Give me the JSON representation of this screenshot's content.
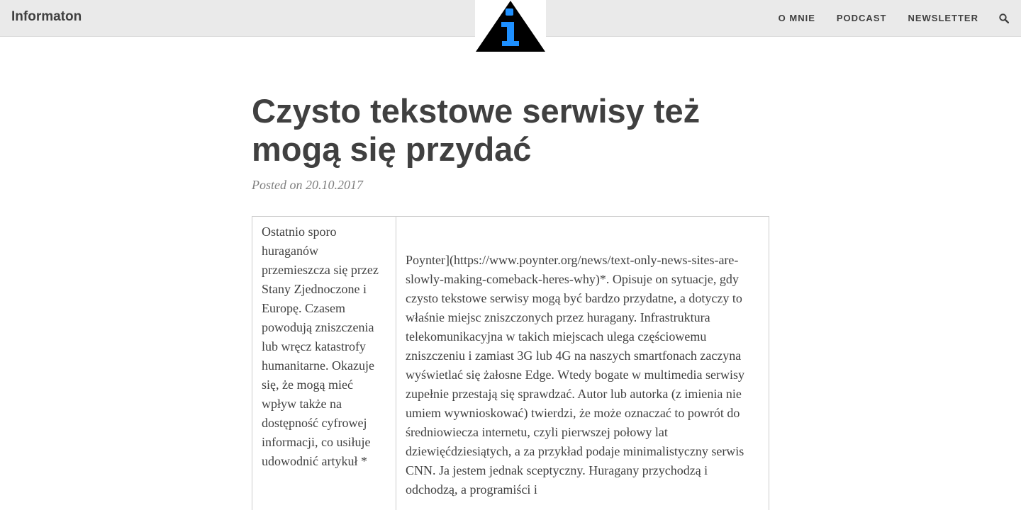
{
  "navbar": {
    "brand": "Informaton",
    "links": [
      {
        "label": "O MNIE"
      },
      {
        "label": "PODCAST"
      },
      {
        "label": "NEWSLETTER"
      }
    ],
    "search_icon": "search-icon",
    "logo": "info-triangle-logo"
  },
  "post": {
    "title": "Czysto tekstowe serwisy też mogą się przydać",
    "meta": "Posted on 20.10.2017",
    "left_column": "Ostatnio sporo huraganów przemieszcza się przez Stany Zjednoczone i Europę. Czasem powodują zniszczenia lub wręcz katastrofy humanitarne. Okazuje się, że mogą mieć wpływ także na dostępność cyfrowej informacji, co usiłuje udowodnić artykuł *",
    "right_column": "Poynter](https://www.poynter.org/news/text-only-news-sites-are-slowly-making-comeback-heres-why)*. Opisuje on sytuacje, gdy czysto tekstowe serwisy mogą być bardzo przydatne, a dotyczy to właśnie miejsc zniszczonych przez huragany. Infrastruktura telekomunikacyjna w takich miejscach ulega częściowemu zniszczeniu i zamiast 3G lub 4G na naszych smartfonach zaczyna wyświetlać się żałosne Edge. Wtedy bogate w multimedia serwisy zupełnie przestają się sprawdzać. Autor lub autorka (z imienia nie umiem wywnioskować) twierdzi, że może oznaczać to powrót do średniowiecza internetu, czyli pierwszej połowy lat dziewięćdziesiątych, a za przykład podaje minimalistyczny serwis CNN. Ja jestem jednak sceptyczny. Huragany przychodzą i odchodzą, a programiści i"
  },
  "colors": {
    "navbar_bg": "#eaeaea",
    "text": "#404040",
    "meta": "#808080",
    "logo_blue": "#1e90ff",
    "logo_black": "#000000"
  }
}
